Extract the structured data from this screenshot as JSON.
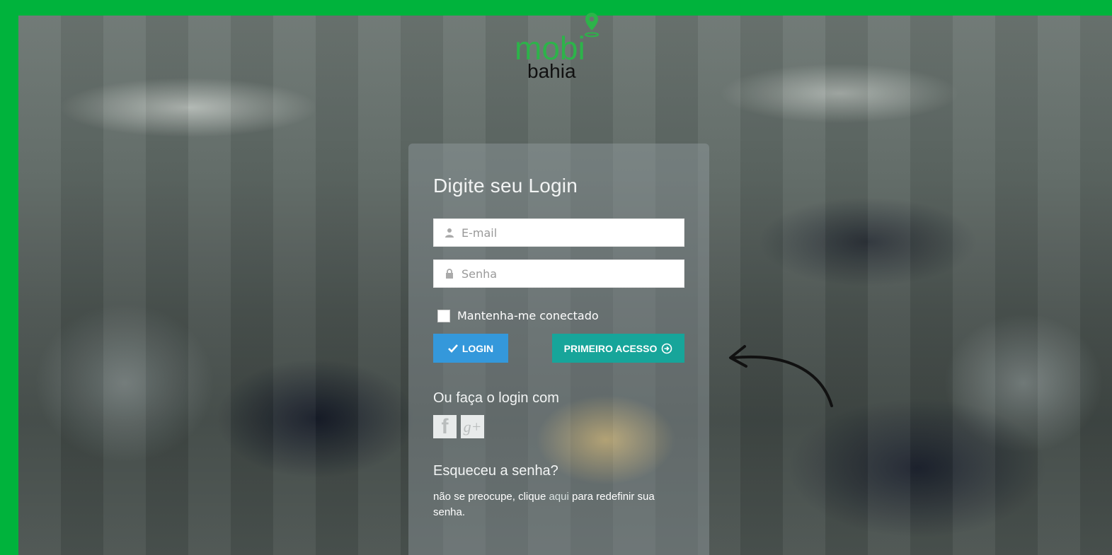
{
  "brand": {
    "logo_top": "mobi",
    "logo_bottom": "bahia",
    "logo_color": "#2db34a",
    "border_color": "#00b33c"
  },
  "login": {
    "title": "Digite seu Login",
    "email_placeholder": "E-mail",
    "password_placeholder": "Senha",
    "remember_label": "Mantenha-me conectado",
    "remember_checked": false,
    "login_button": "LOGIN",
    "first_access_button": "PRIMEIRO ACESSO",
    "login_button_color": "#3498db",
    "first_access_color": "#17a59a"
  },
  "social": {
    "title": "Ou faça o login com",
    "items": [
      {
        "icon": "facebook-icon",
        "glyph": "f"
      },
      {
        "icon": "google-plus-icon",
        "glyph": "g+"
      }
    ]
  },
  "forgot": {
    "title": "Esqueceu a senha?",
    "text_before": "não se preocupe, clique ",
    "link": "aqui",
    "text_after": " para redefinir sua senha."
  }
}
